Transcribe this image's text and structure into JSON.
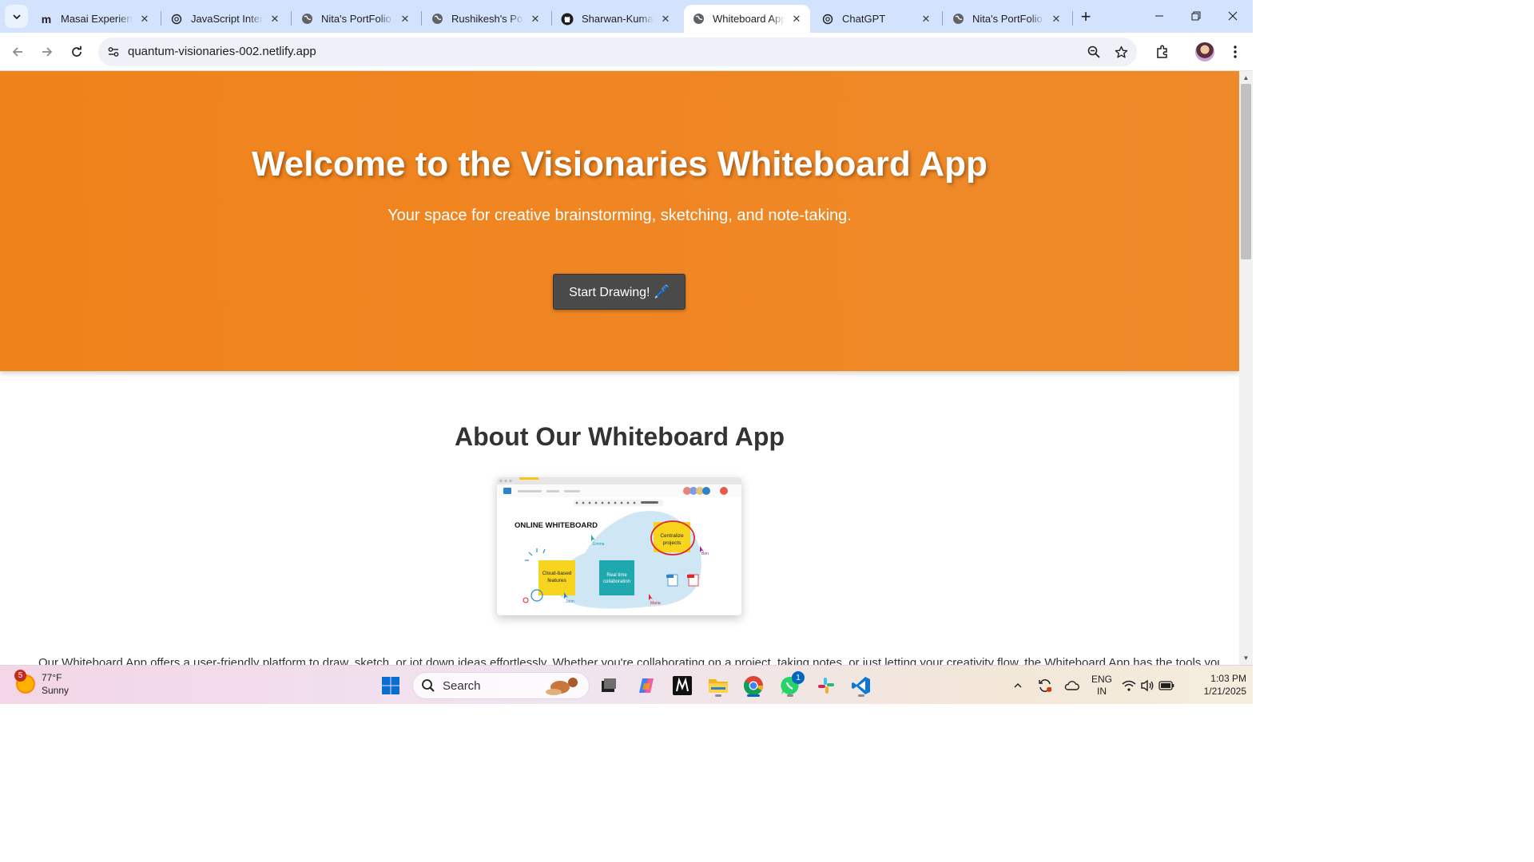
{
  "browser": {
    "tabs": [
      {
        "title": "Masai Experience",
        "icon": "masai-logo-icon",
        "active": false
      },
      {
        "title": "JavaScript Interview",
        "icon": "chatgpt-logo-icon",
        "active": false
      },
      {
        "title": "Nita's PortFolio",
        "icon": "globe-icon",
        "active": false
      },
      {
        "title": "Rushikesh's Portfolio",
        "icon": "globe-icon",
        "active": false
      },
      {
        "title": "Sharwan-Kumar",
        "icon": "github-logo-icon",
        "active": false
      },
      {
        "title": "Whiteboard App",
        "icon": "globe-icon",
        "active": true
      },
      {
        "title": "ChatGPT",
        "icon": "chatgpt-logo-icon",
        "active": false
      },
      {
        "title": "Nita's PortFolio",
        "icon": "globe-icon",
        "active": false
      }
    ],
    "url": "quantum-visionaries-002.netlify.app"
  },
  "page": {
    "hero": {
      "title": "Welcome to the Visionaries Whiteboard App",
      "subtitle": "Your space for creative brainstorming, sketching, and note-taking.",
      "button_label": "Start Drawing! 🖊️"
    },
    "about": {
      "title": "About Our Whiteboard App",
      "image": {
        "heading": "ONLINE WHITEBOARD",
        "note_centralize": "Centralize projects",
        "note_cloud": "Cloud-based features",
        "note_realtime": "Real time collaboration",
        "cursor_names": [
          "Emma",
          "Ben",
          "John",
          "Maria"
        ]
      },
      "text": "Our Whiteboard App offers a user-friendly platform to draw, sketch, or jot down ideas effortlessly. Whether you're collaborating on a project, taking notes, or just letting your creativity flow, the Whiteboard App has the tools you"
    }
  },
  "taskbar": {
    "weather": {
      "temp": "77°F",
      "condition": "Sunny",
      "badge": "5"
    },
    "search_placeholder": "Search",
    "whatsapp_badge": "1",
    "language": {
      "line1": "ENG",
      "line2": "IN"
    },
    "time": "1:03 PM",
    "date": "1/21/2025"
  },
  "colors": {
    "hero_orange": "#f0821b",
    "button_dark": "#4a4a4a",
    "tabstrip": "#d3e3fd"
  }
}
